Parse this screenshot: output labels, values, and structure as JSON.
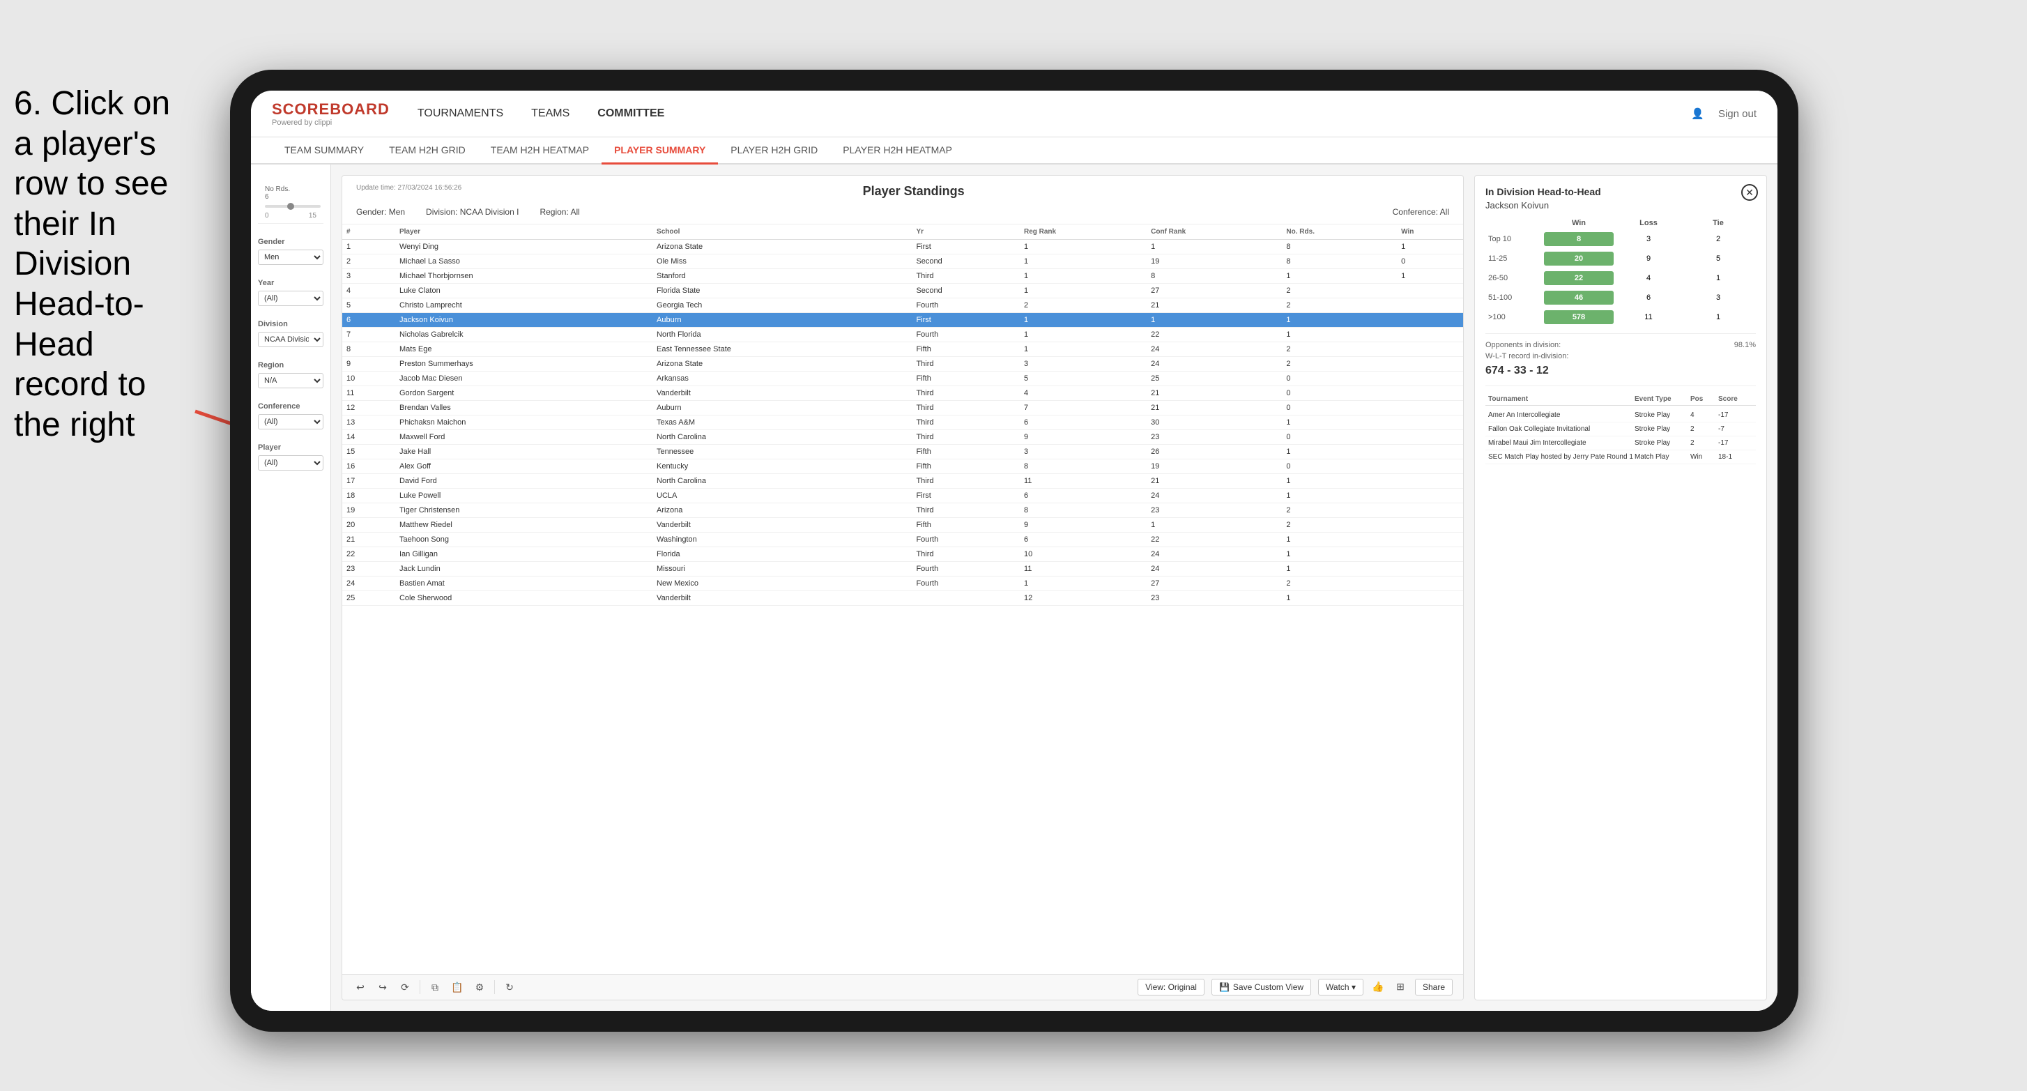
{
  "instruction": {
    "text": "6. Click on a player's row to see their In Division Head-to-Head record to the right"
  },
  "nav": {
    "logo": "SCOREBOARD",
    "logo_sub": "Powered by clippi",
    "links": [
      "TOURNAMENTS",
      "TEAMS",
      "COMMITTEE"
    ],
    "sign_out": "Sign out"
  },
  "sub_nav": {
    "items": [
      "TEAM SUMMARY",
      "TEAM H2H GRID",
      "TEAM H2H HEATMAP",
      "PLAYER SUMMARY",
      "PLAYER H2H GRID",
      "PLAYER H2H HEATMAP"
    ],
    "active": "PLAYER SUMMARY"
  },
  "sidebar": {
    "no_rds_label": "No Rds.",
    "no_rds_values": "6",
    "gender_label": "Gender",
    "gender_value": "Men",
    "year_label": "Year",
    "year_value": "(All)",
    "division_label": "Division",
    "division_value": "NCAA Division I",
    "region_label": "Region",
    "region_value": "N/A",
    "conference_label": "Conference",
    "conference_value": "(All)",
    "player_label": "Player",
    "player_value": "(All)"
  },
  "panel": {
    "update_time_label": "Update time:",
    "update_time": "27/03/2024 16:56:26",
    "title": "Player Standings",
    "gender_label": "Gender:",
    "gender_value": "Men",
    "division_label": "Division:",
    "division_value": "NCAA Division I",
    "region_label": "Region:",
    "region_value": "All",
    "conference_label": "Conference:",
    "conference_value": "All"
  },
  "table": {
    "headers": [
      "#",
      "Player",
      "School",
      "Yr",
      "Reg Rank",
      "Conf Rank",
      "No. Rds.",
      "Win"
    ],
    "rows": [
      {
        "num": "1",
        "player": "Wenyi Ding",
        "school": "Arizona State",
        "yr": "First",
        "reg": "1",
        "conf": "1",
        "rds": "8",
        "win": "1"
      },
      {
        "num": "2",
        "player": "Michael La Sasso",
        "school": "Ole Miss",
        "yr": "Second",
        "reg": "1",
        "conf": "19",
        "rds": "8",
        "win": "0"
      },
      {
        "num": "3",
        "player": "Michael Thorbjornsen",
        "school": "Stanford",
        "yr": "Third",
        "reg": "1",
        "conf": "8",
        "rds": "1",
        "win": "1"
      },
      {
        "num": "4",
        "player": "Luke Claton",
        "school": "Florida State",
        "yr": "Second",
        "reg": "1",
        "conf": "27",
        "rds": "2",
        "win": ""
      },
      {
        "num": "5",
        "player": "Christo Lamprecht",
        "school": "Georgia Tech",
        "yr": "Fourth",
        "reg": "2",
        "conf": "21",
        "rds": "2",
        "win": ""
      },
      {
        "num": "6",
        "player": "Jackson Koivun",
        "school": "Auburn",
        "yr": "First",
        "reg": "1",
        "conf": "1",
        "rds": "1",
        "win": ""
      },
      {
        "num": "7",
        "player": "Nicholas Gabrelcik",
        "school": "North Florida",
        "yr": "Fourth",
        "reg": "1",
        "conf": "22",
        "rds": "1",
        "win": ""
      },
      {
        "num": "8",
        "player": "Mats Ege",
        "school": "East Tennessee State",
        "yr": "Fifth",
        "reg": "1",
        "conf": "24",
        "rds": "2",
        "win": ""
      },
      {
        "num": "9",
        "player": "Preston Summerhays",
        "school": "Arizona State",
        "yr": "Third",
        "reg": "3",
        "conf": "24",
        "rds": "2",
        "win": ""
      },
      {
        "num": "10",
        "player": "Jacob Mac Diesen",
        "school": "Arkansas",
        "yr": "Fifth",
        "reg": "5",
        "conf": "25",
        "rds": "0",
        "win": ""
      },
      {
        "num": "11",
        "player": "Gordon Sargent",
        "school": "Vanderbilt",
        "yr": "Third",
        "reg": "4",
        "conf": "21",
        "rds": "0",
        "win": ""
      },
      {
        "num": "12",
        "player": "Brendan Valles",
        "school": "Auburn",
        "yr": "Third",
        "reg": "7",
        "conf": "21",
        "rds": "0",
        "win": ""
      },
      {
        "num": "13",
        "player": "Phichaksn Maichon",
        "school": "Texas A&M",
        "yr": "Third",
        "reg": "6",
        "conf": "30",
        "rds": "1",
        "win": ""
      },
      {
        "num": "14",
        "player": "Maxwell Ford",
        "school": "North Carolina",
        "yr": "Third",
        "reg": "9",
        "conf": "23",
        "rds": "0",
        "win": ""
      },
      {
        "num": "15",
        "player": "Jake Hall",
        "school": "Tennessee",
        "yr": "Fifth",
        "reg": "3",
        "conf": "26",
        "rds": "1",
        "win": ""
      },
      {
        "num": "16",
        "player": "Alex Goff",
        "school": "Kentucky",
        "yr": "Fifth",
        "reg": "8",
        "conf": "19",
        "rds": "0",
        "win": ""
      },
      {
        "num": "17",
        "player": "David Ford",
        "school": "North Carolina",
        "yr": "Third",
        "reg": "11",
        "conf": "21",
        "rds": "1",
        "win": ""
      },
      {
        "num": "18",
        "player": "Luke Powell",
        "school": "UCLA",
        "yr": "First",
        "reg": "6",
        "conf": "24",
        "rds": "1",
        "win": ""
      },
      {
        "num": "19",
        "player": "Tiger Christensen",
        "school": "Arizona",
        "yr": "Third",
        "reg": "8",
        "conf": "23",
        "rds": "2",
        "win": ""
      },
      {
        "num": "20",
        "player": "Matthew Riedel",
        "school": "Vanderbilt",
        "yr": "Fifth",
        "reg": "9",
        "conf": "1",
        "rds": "2",
        "win": ""
      },
      {
        "num": "21",
        "player": "Taehoon Song",
        "school": "Washington",
        "yr": "Fourth",
        "reg": "6",
        "conf": "22",
        "rds": "1",
        "win": ""
      },
      {
        "num": "22",
        "player": "Ian Gilligan",
        "school": "Florida",
        "yr": "Third",
        "reg": "10",
        "conf": "24",
        "rds": "1",
        "win": ""
      },
      {
        "num": "23",
        "player": "Jack Lundin",
        "school": "Missouri",
        "yr": "Fourth",
        "reg": "11",
        "conf": "24",
        "rds": "1",
        "win": ""
      },
      {
        "num": "24",
        "player": "Bastien Amat",
        "school": "New Mexico",
        "yr": "Fourth",
        "reg": "1",
        "conf": "27",
        "rds": "2",
        "win": ""
      },
      {
        "num": "25",
        "player": "Cole Sherwood",
        "school": "Vanderbilt",
        "yr": "",
        "reg": "12",
        "conf": "23",
        "rds": "1",
        "win": ""
      }
    ],
    "selected_index": 5
  },
  "h2h": {
    "title": "In Division Head-to-Head",
    "player_name": "Jackson Koivun",
    "col_win": "Win",
    "col_loss": "Loss",
    "col_tie": "Tie",
    "rows": [
      {
        "label": "Top 10",
        "win": "8",
        "loss": "3",
        "tie": "2"
      },
      {
        "label": "11-25",
        "win": "20",
        "loss": "9",
        "tie": "5"
      },
      {
        "label": "26-50",
        "win": "22",
        "loss": "4",
        "tie": "1"
      },
      {
        "label": "51-100",
        "win": "46",
        "loss": "6",
        "tie": "3"
      },
      {
        "label": ">100",
        "win": "578",
        "loss": "11",
        "tie": "1"
      }
    ],
    "opponents_label": "Opponents in division:",
    "wl_label": "W-L-T record in-division:",
    "opponents_pct": "98.1%",
    "record": "674 - 33 - 12",
    "tournament_headers": [
      "Tournament",
      "Event Type",
      "Pos",
      "Score"
    ],
    "tournaments": [
      {
        "name": "Amer An Intercollegiate",
        "type": "Stroke Play",
        "pos": "4",
        "score": "-17"
      },
      {
        "name": "Fallon Oak Collegiate Invitational",
        "type": "Stroke Play",
        "pos": "2",
        "score": "-7"
      },
      {
        "name": "Mirabel Maui Jim Intercollegiate",
        "type": "Stroke Play",
        "pos": "2",
        "score": "-17"
      },
      {
        "name": "SEC Match Play hosted by Jerry Pate Round 1",
        "type": "Match Play",
        "pos": "Win",
        "score": "18-1"
      }
    ]
  },
  "toolbar": {
    "view_original": "View: Original",
    "save_custom": "Save Custom View",
    "watch": "Watch ▾",
    "share": "Share"
  }
}
